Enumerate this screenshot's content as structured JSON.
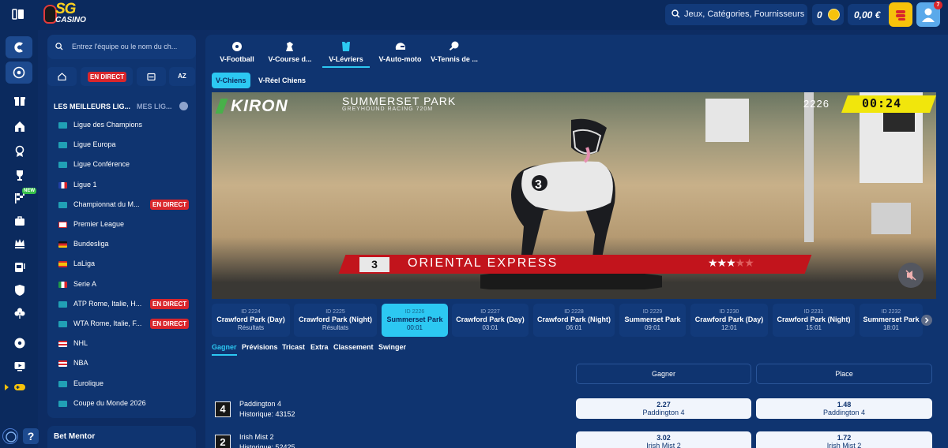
{
  "header": {
    "logo_top": "SG",
    "logo_bottom": "CASINO",
    "search_placeholder": "Jeux, Catégories, Fournisseurs",
    "coins": "0",
    "balance": "0,00 €",
    "notification_count": "7"
  },
  "sidebar": {
    "search_placeholder": "Entrez l'équipe ou le nom du ch...",
    "live_filter": "EN DIRECT",
    "az_filter": "AZ",
    "best_leagues_title": "LES MEILLEURS LIG...",
    "my_leagues_title": "MES LIG...",
    "new_badge": "NEW",
    "leagues": [
      {
        "name": "Ligue des Champions",
        "live": ""
      },
      {
        "name": "Ligue Europa",
        "live": ""
      },
      {
        "name": "Ligue Conférence",
        "live": ""
      },
      {
        "name": "Ligue 1",
        "live": ""
      },
      {
        "name": "Championnat du M...",
        "live": "EN DIRECT"
      },
      {
        "name": "Premier League",
        "live": ""
      },
      {
        "name": "Bundesliga",
        "live": ""
      },
      {
        "name": "LaLiga",
        "live": ""
      },
      {
        "name": "Serie A",
        "live": ""
      },
      {
        "name": "ATP Rome, Italie, H...",
        "live": "EN DIRECT"
      },
      {
        "name": "WTA Rome, Italie, F...",
        "live": "EN DIRECT"
      },
      {
        "name": "NHL",
        "live": ""
      },
      {
        "name": "NBA",
        "live": ""
      },
      {
        "name": "Eurolique",
        "live": ""
      },
      {
        "name": "Coupe du Monde 2026",
        "live": ""
      }
    ],
    "bet_mentor": "Bet Mentor"
  },
  "virtual_tabs": [
    "V-Football",
    "V-Course d...",
    "V-Lévriers",
    "V-Auto-moto",
    "V-Tennis de ..."
  ],
  "sub_tabs": [
    "V-Chiens",
    "V-Réel Chiens"
  ],
  "video": {
    "brand": "KIRON",
    "track_name": "SUMMERSET PARK",
    "track_sub": "GREYHOUND RACING     720M",
    "race_id": "2226",
    "timer": "00:24",
    "runner_number": "3",
    "runner_name": "ORIENTAL EXPRESS",
    "stars": 3.5
  },
  "races": [
    {
      "id": "ID 2224",
      "track": "Crawford Park (Day)",
      "status": "Résultats"
    },
    {
      "id": "ID 2225",
      "track": "Crawford Park (Night)",
      "status": "Résultats"
    },
    {
      "id": "ID 2226",
      "track": "Summerset Park",
      "status": "00:01"
    },
    {
      "id": "ID 2227",
      "track": "Crawford Park (Day)",
      "status": "03:01"
    },
    {
      "id": "ID 2228",
      "track": "Crawford Park (Night)",
      "status": "06:01"
    },
    {
      "id": "ID 2229",
      "track": "Summerset Park",
      "status": "09:01"
    },
    {
      "id": "ID 2230",
      "track": "Crawford Park (Day)",
      "status": "12:01"
    },
    {
      "id": "ID 2231",
      "track": "Crawford Park (Night)",
      "status": "15:01"
    },
    {
      "id": "ID 2232",
      "track": "Summerset Park",
      "status": "18:01"
    }
  ],
  "bet_tabs": [
    "Gagner",
    "Prévisions",
    "Tricast",
    "Extra",
    "Classement",
    "Swinger"
  ],
  "columns": [
    "Gagner",
    "Place"
  ],
  "runners": [
    {
      "number": "4",
      "name": "Paddington 4",
      "history": "Historique: 43152",
      "win": "2.27",
      "place": "1.48"
    },
    {
      "number": "2",
      "name": "Irish Mist 2",
      "history": "Historique: 52425",
      "win": "3.02",
      "place": "1.72"
    }
  ]
}
